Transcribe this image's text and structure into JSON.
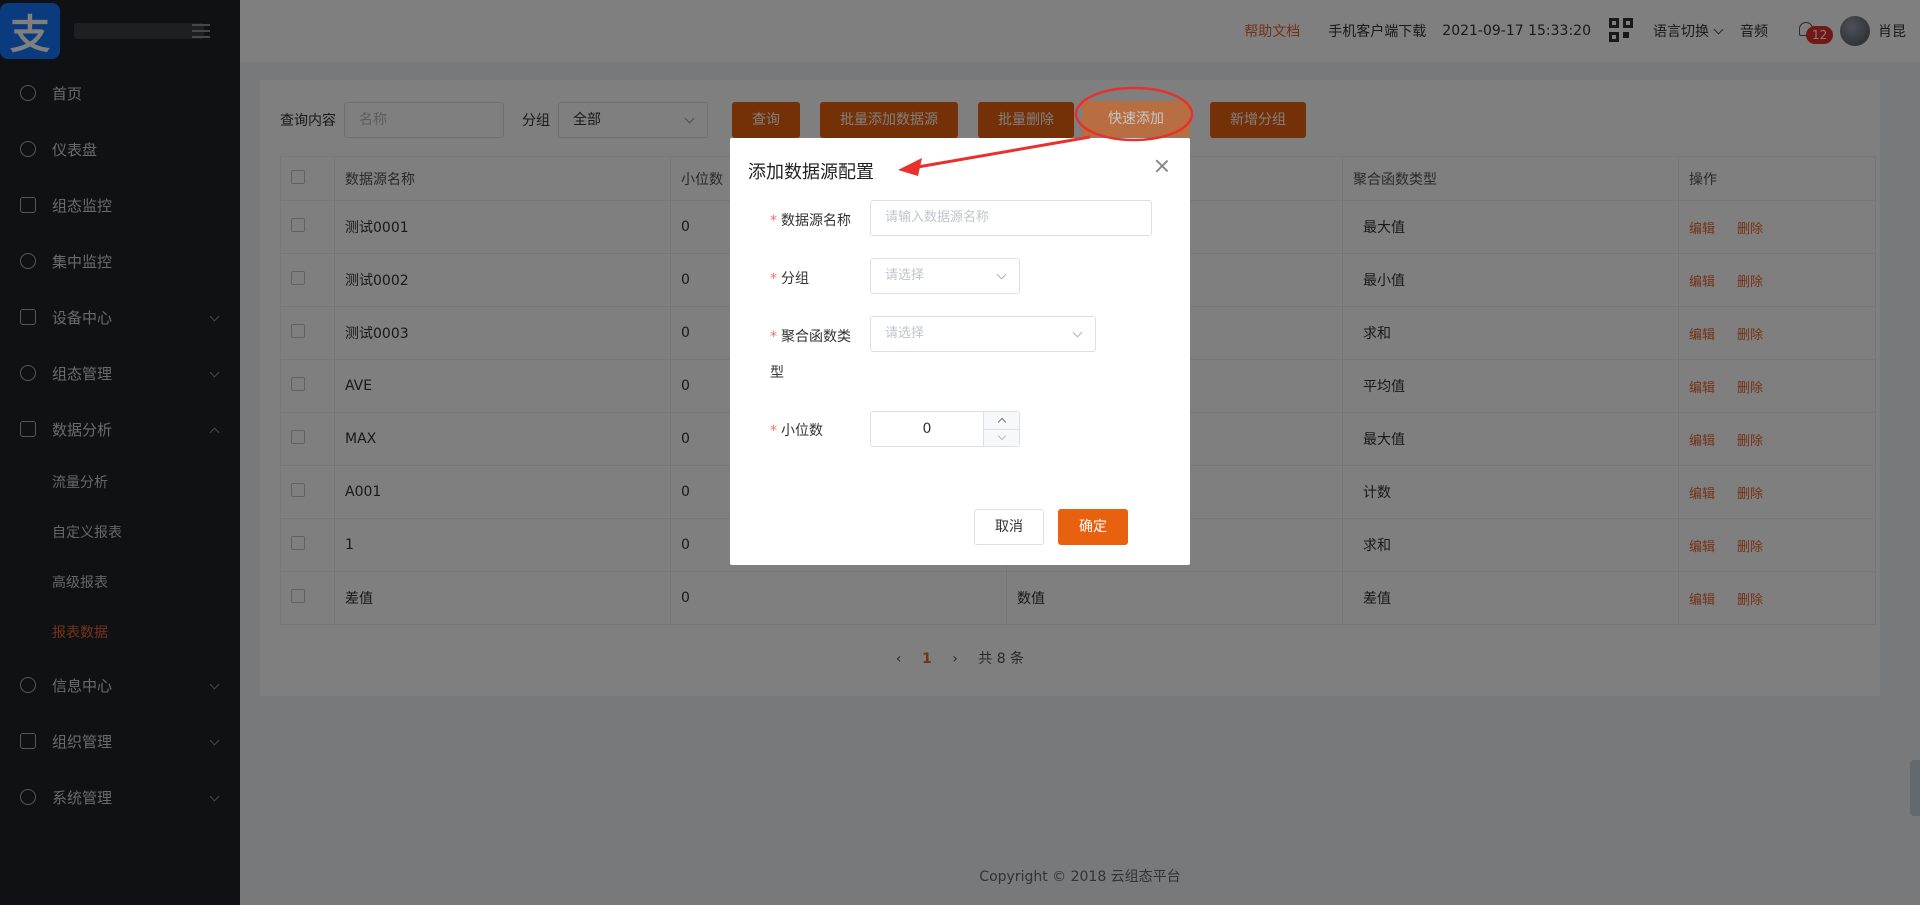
{
  "sidebar": {
    "logo_glyph": "支",
    "items": [
      {
        "label": "首页",
        "icon": "user-icon"
      },
      {
        "label": "仪表盘",
        "icon": "dashboard-icon"
      },
      {
        "label": "组态监控",
        "icon": "monitor-icon"
      },
      {
        "label": "集中监控",
        "icon": "location-icon"
      },
      {
        "label": "设备中心",
        "icon": "device-icon"
      },
      {
        "label": "组态管理",
        "icon": "cloud-icon"
      },
      {
        "label": "数据分析",
        "icon": "edit-icon"
      },
      {
        "label": "信息中心",
        "icon": "message-icon"
      },
      {
        "label": "组织管理",
        "icon": "org-icon"
      },
      {
        "label": "系统管理",
        "icon": "settings-icon"
      }
    ],
    "sub_items": [
      "流量分析",
      "自定义报表",
      "高级报表",
      "报表数据"
    ],
    "active_sub": "报表数据"
  },
  "header": {
    "help": "帮助文档",
    "download": "手机客户端下载",
    "datetime": "2021-09-17 15:33:20",
    "language": "语言切换",
    "audio": "音频",
    "notification_count": "12",
    "username": "肖昆"
  },
  "filter": {
    "query_label": "查询内容",
    "query_placeholder": "名称",
    "group_label": "分组",
    "group_value": "全部",
    "buttons": [
      "查询",
      "批量添加数据源",
      "批量删除",
      "快速添加",
      "新增分组"
    ]
  },
  "table": {
    "headers": [
      "数据源名称",
      "小位数",
      "",
      "聚合函数类型",
      "操作"
    ],
    "rows": [
      {
        "name": "测试0001",
        "decimals": "0",
        "type": "",
        "agg": "最大值"
      },
      {
        "name": "测试0002",
        "decimals": "0",
        "type": "",
        "agg": "最小值"
      },
      {
        "name": "测试0003",
        "decimals": "0",
        "type": "",
        "agg": "求和"
      },
      {
        "name": "AVE",
        "decimals": "0",
        "type": "",
        "agg": "平均值"
      },
      {
        "name": "MAX",
        "decimals": "0",
        "type": "",
        "agg": "最大值"
      },
      {
        "name": "A001",
        "decimals": "0",
        "type": "",
        "agg": "计数"
      },
      {
        "name": "1",
        "decimals": "0",
        "type": "",
        "agg": "求和"
      },
      {
        "name": "差值",
        "decimals": "0",
        "type": "数值",
        "agg": "差值"
      }
    ],
    "edit_label": "编辑",
    "delete_label": "删除"
  },
  "pagination": {
    "current": "1",
    "total": "共 8 条"
  },
  "footer": "Copyright © 2018 云组态平台",
  "dialog": {
    "title": "添加数据源配置",
    "name_label": "数据源名称",
    "name_placeholder": "请输入数据源名称",
    "group_label": "分组",
    "group_placeholder": "请选择",
    "agg_label_line1": "聚合函数类",
    "agg_label_line2": "型",
    "agg_placeholder": "请选择",
    "decimals_label": "小位数",
    "decimals_value": "0",
    "cancel": "取消",
    "confirm": "确定"
  },
  "colors": {
    "accent": "#e8610f",
    "annotation": "#e8312c",
    "sidebar_bg": "#1f2329"
  }
}
